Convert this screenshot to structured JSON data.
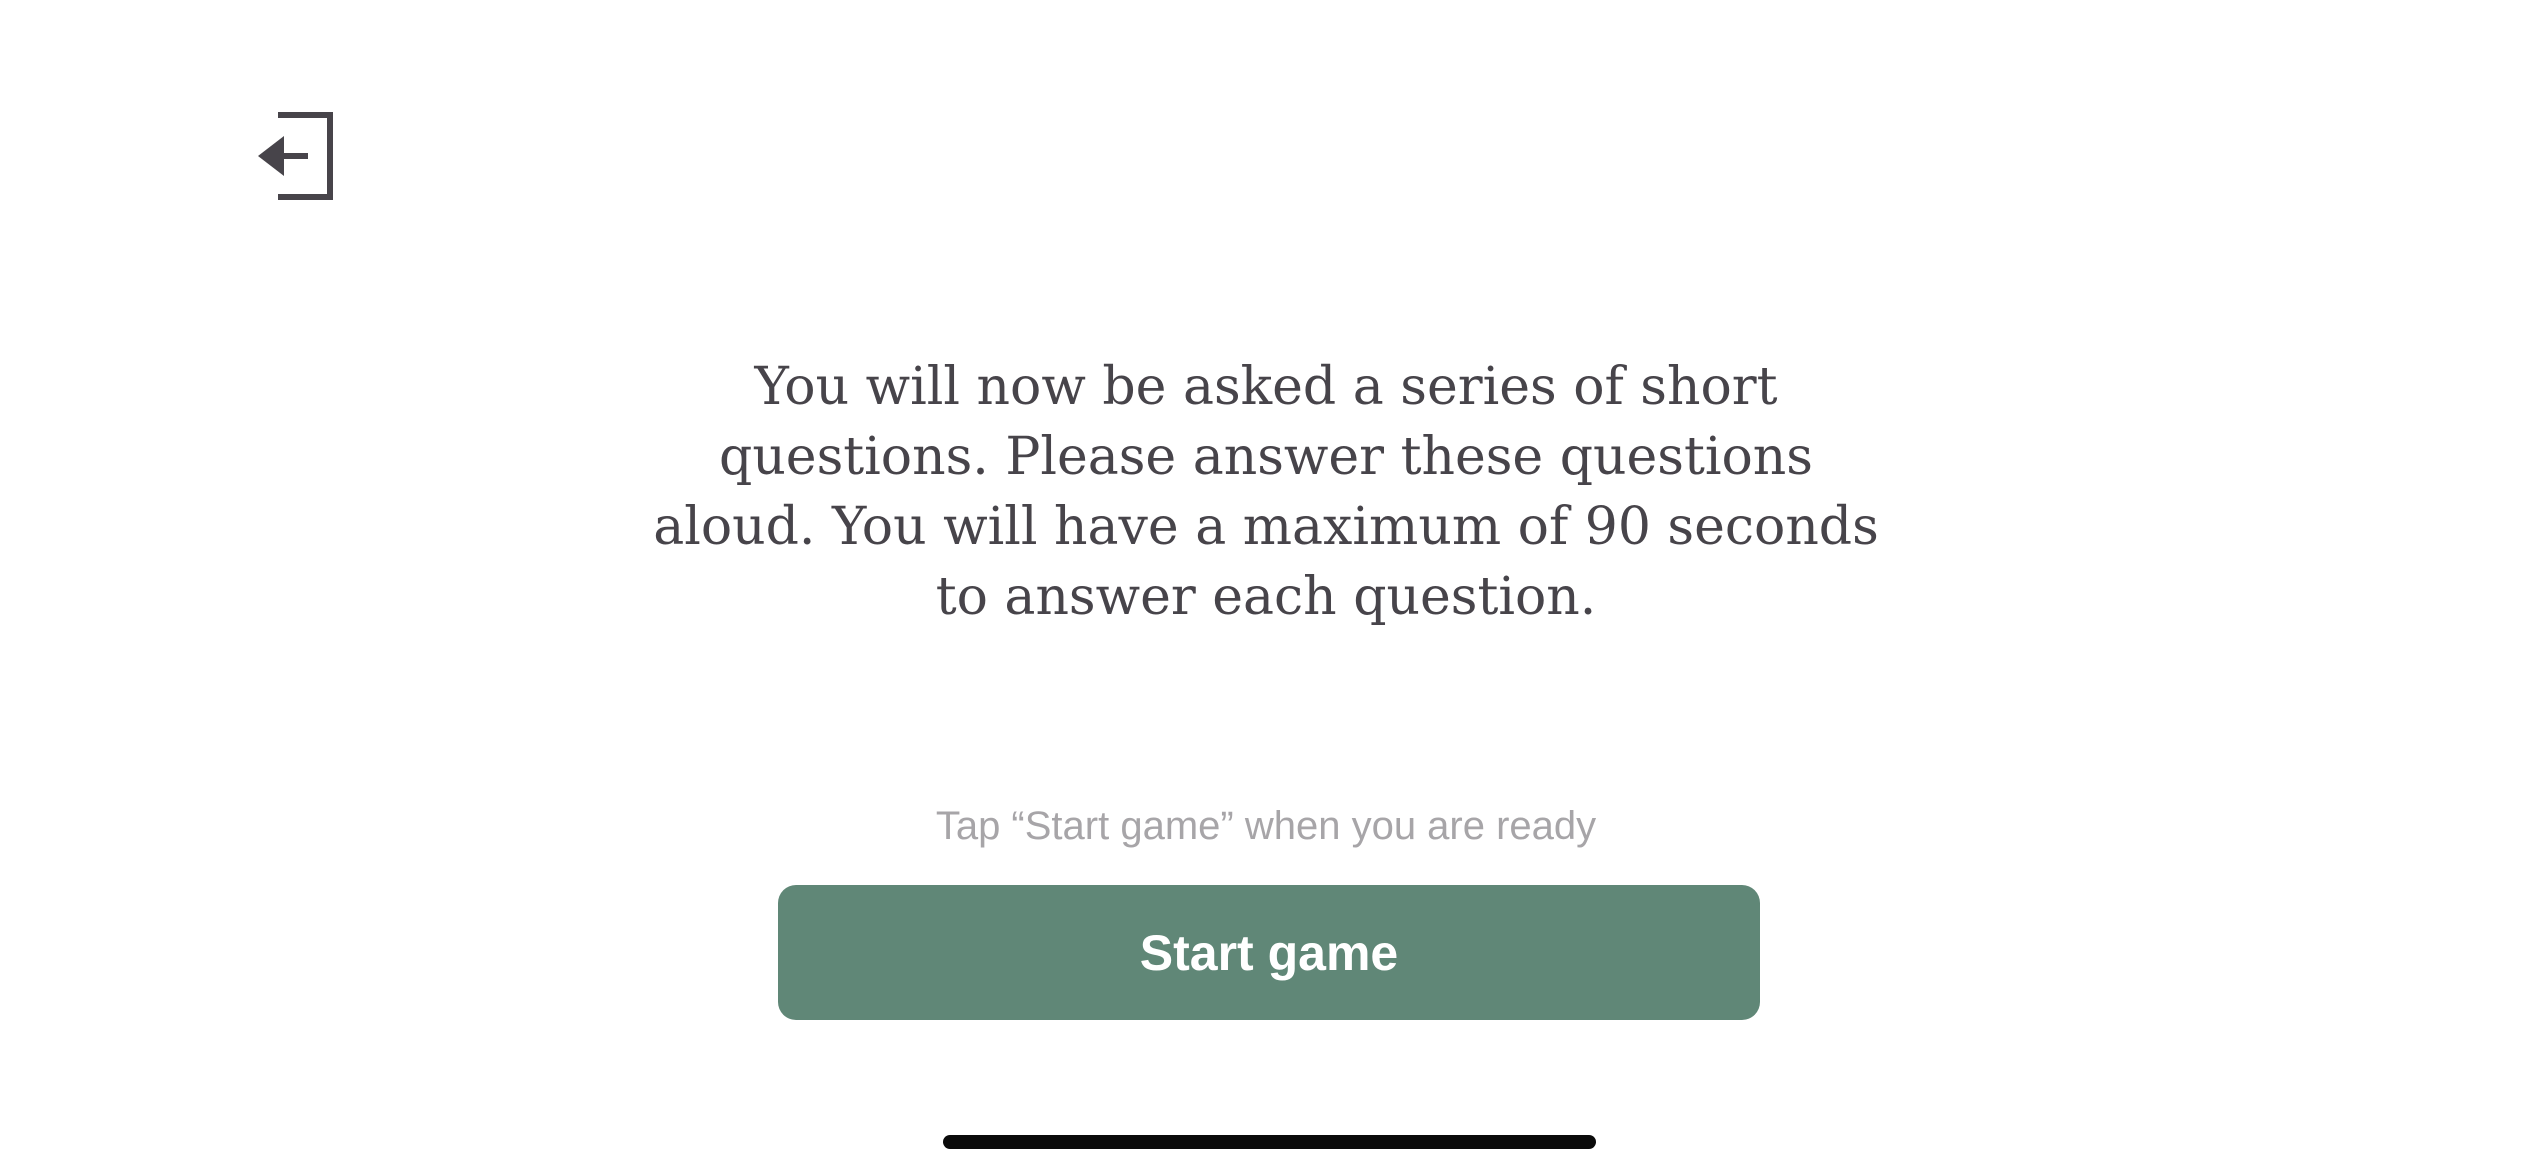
{
  "header": {
    "exit_icon": "exit-arrow-icon"
  },
  "main": {
    "instructions": "You will now be asked a series of short questions. Please answer these questions aloud. You will have a maximum of 90 seconds to answer each question.",
    "hint": "Tap “Start game” when you are ready",
    "start_button_label": "Start game"
  },
  "colors": {
    "text": "#47444a",
    "hint": "#a7a5a8",
    "button": "#608777",
    "button_text": "#ffffff"
  }
}
